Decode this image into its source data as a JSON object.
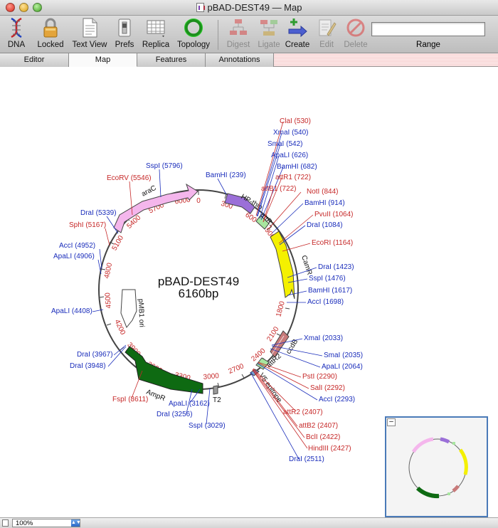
{
  "window": {
    "title": "pBAD-DEST49 — Map"
  },
  "toolbar": {
    "buttons": [
      {
        "label": "DNA",
        "icon": "dna-helix-icon",
        "enabled": true
      },
      {
        "label": "Locked",
        "icon": "padlock-icon",
        "enabled": true
      },
      {
        "label": "Text View",
        "icon": "text-document-icon",
        "enabled": true
      },
      {
        "label": "Prefs",
        "icon": "prefs-switch-icon",
        "enabled": true
      },
      {
        "label": "Replica",
        "icon": "replica-plate-icon",
        "enabled": true
      },
      {
        "label": "Topology",
        "icon": "circle-topology-icon",
        "enabled": true
      },
      {
        "label": "Digest",
        "icon": "digest-icon",
        "enabled": false
      },
      {
        "label": "Ligate",
        "icon": "ligate-icon",
        "enabled": false
      },
      {
        "label": "Create",
        "icon": "create-arrow-icon",
        "enabled": true
      },
      {
        "label": "Edit",
        "icon": "edit-pencil-icon",
        "enabled": false
      },
      {
        "label": "Delete",
        "icon": "delete-icon",
        "enabled": false
      }
    ],
    "range_label": "Range",
    "range_value": ""
  },
  "tabs": [
    "Editor",
    "Map",
    "Features",
    "Annotations"
  ],
  "active_tab": "Map",
  "map": {
    "name": "pBAD-DEST49",
    "size_label": "6160bp",
    "length": 6160,
    "ticks": [
      "0",
      "300",
      "600",
      "900",
      "1200",
      "1500",
      "1800",
      "2100",
      "2400",
      "2700",
      "3000",
      "3300",
      "3600",
      "3900",
      "4200",
      "4500",
      "4800",
      "5100",
      "5400",
      "5700",
      "6000"
    ],
    "features": [
      {
        "name": "HP-thio",
        "color": "#9b6fd8"
      },
      {
        "name": "attR1",
        "color": "#a8e6a0"
      },
      {
        "name": "CamR",
        "color": "#f4f000"
      },
      {
        "name": "ccdB",
        "color": "#c87a7a"
      },
      {
        "name": "attR2",
        "color": "#a8e6a0"
      },
      {
        "name": "V5 epitope",
        "color": "#6fa0d8"
      },
      {
        "name": "T2",
        "color": "#9a9a9a"
      },
      {
        "name": "AmpR",
        "color": "#0e6a12"
      },
      {
        "name": "pMB1 ori",
        "color": "#ffffff"
      },
      {
        "name": "araC",
        "color": "#f4b6ec"
      }
    ],
    "sites": [
      {
        "label": "ClaI  (530)",
        "color": "#c62828"
      },
      {
        "label": "XmaI  (540)",
        "color": "#1a2dbb"
      },
      {
        "label": "SmaI  (542)",
        "color": "#1a2dbb"
      },
      {
        "label": "ApaLI  (626)",
        "color": "#1a2dbb"
      },
      {
        "label": "BamHI  (682)",
        "color": "#1a2dbb"
      },
      {
        "label": "attR1  (722)",
        "color": "#c62828"
      },
      {
        "label": "attB1  (722)",
        "color": "#c62828"
      },
      {
        "label": "NotI  (844)",
        "color": "#c62828"
      },
      {
        "label": "BamHI  (914)",
        "color": "#1a2dbb"
      },
      {
        "label": "PvuII  (1064)",
        "color": "#c62828"
      },
      {
        "label": "DraI  (1084)",
        "color": "#1a2dbb"
      },
      {
        "label": "EcoRI  (1164)",
        "color": "#c62828"
      },
      {
        "label": "DraI  (1423)",
        "color": "#1a2dbb"
      },
      {
        "label": "SspI  (1476)",
        "color": "#1a2dbb"
      },
      {
        "label": "BamHI  (1617)",
        "color": "#1a2dbb"
      },
      {
        "label": "AccI  (1698)",
        "color": "#1a2dbb"
      },
      {
        "label": "XmaI  (2033)",
        "color": "#1a2dbb"
      },
      {
        "label": "SmaI  (2035)",
        "color": "#1a2dbb"
      },
      {
        "label": "ApaLI  (2064)",
        "color": "#1a2dbb"
      },
      {
        "label": "PstI  (2290)",
        "color": "#c62828"
      },
      {
        "label": "SalI  (2292)",
        "color": "#c62828"
      },
      {
        "label": "AccI  (2293)",
        "color": "#1a2dbb"
      },
      {
        "label": "attR2  (2407)",
        "color": "#c62828"
      },
      {
        "label": "attB2  (2407)",
        "color": "#c62828"
      },
      {
        "label": "BclI  (2422)",
        "color": "#c62828"
      },
      {
        "label": "HindIII  (2427)",
        "color": "#c62828"
      },
      {
        "label": "DraI  (2511)",
        "color": "#1a2dbb"
      },
      {
        "label": "BamHI  (239)",
        "color": "#1a2dbb"
      },
      {
        "label": "SspI  (5796)",
        "color": "#1a2dbb"
      },
      {
        "label": "EcoRV  (5546)",
        "color": "#c62828"
      },
      {
        "label": "DraI  (5339)",
        "color": "#1a2dbb"
      },
      {
        "label": "SphI  (5167)",
        "color": "#c62828"
      },
      {
        "label": "AccI  (4952)",
        "color": "#1a2dbb"
      },
      {
        "label": "ApaLI  (4906)",
        "color": "#1a2dbb"
      },
      {
        "label": "ApaLI  (4408)",
        "color": "#1a2dbb"
      },
      {
        "label": "DraI  (3967)",
        "color": "#1a2dbb"
      },
      {
        "label": "DraI  (3948)",
        "color": "#1a2dbb"
      },
      {
        "label": "FspI  (3611)",
        "color": "#c62828"
      },
      {
        "label": "ApaLI  (3162)",
        "color": "#1a2dbb"
      },
      {
        "label": "DraI  (3256)",
        "color": "#1a2dbb"
      },
      {
        "label": "SspI  (3029)",
        "color": "#1a2dbb"
      }
    ]
  },
  "statusbar": {
    "zoom": "100%"
  }
}
